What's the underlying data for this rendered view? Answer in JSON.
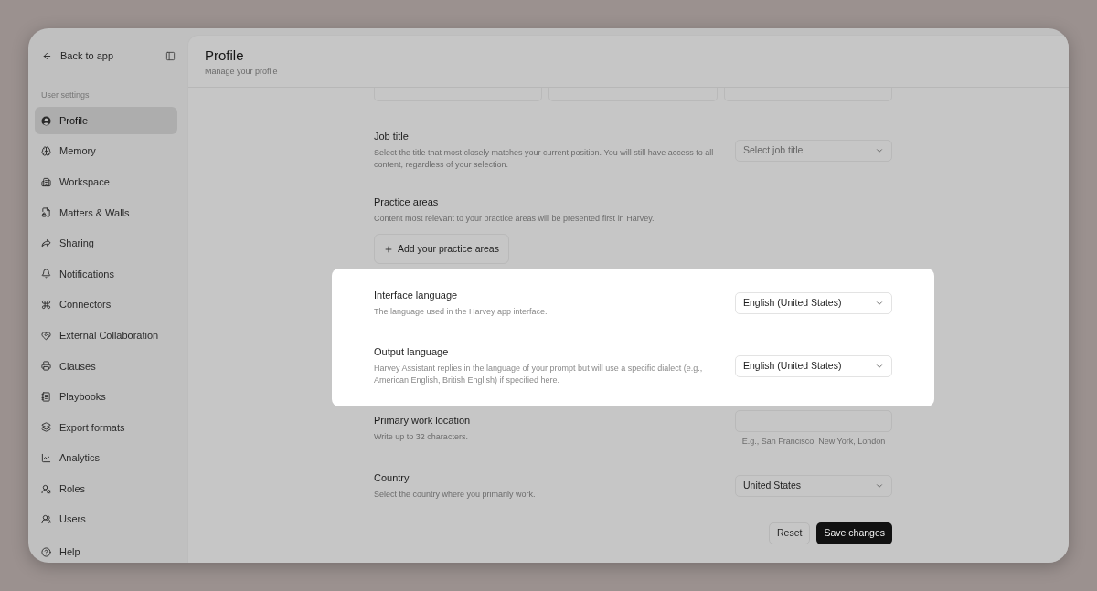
{
  "sidebar": {
    "back": "Back to app",
    "section": "User settings",
    "items": [
      {
        "label": "Profile",
        "selected": true
      },
      {
        "label": "Memory",
        "selected": false
      },
      {
        "label": "Workspace",
        "selected": false
      },
      {
        "label": "Matters & Walls",
        "selected": false
      },
      {
        "label": "Sharing",
        "selected": false
      },
      {
        "label": "Notifications",
        "selected": false
      },
      {
        "label": "Connectors",
        "selected": false
      },
      {
        "label": "External Collaboration",
        "selected": false
      },
      {
        "label": "Clauses",
        "selected": false
      },
      {
        "label": "Playbooks",
        "selected": false
      },
      {
        "label": "Export formats",
        "selected": false
      },
      {
        "label": "Analytics",
        "selected": false
      },
      {
        "label": "Roles",
        "selected": false
      },
      {
        "label": "Users",
        "selected": false
      }
    ],
    "footer": [
      {
        "label": "Help",
        "selected": false
      }
    ]
  },
  "header": {
    "title": "Profile",
    "subtitle": "Manage your profile"
  },
  "form": {
    "partial_inputs": [
      {
        "kind": "input"
      },
      {
        "kind": "input"
      },
      {
        "kind": "input"
      }
    ],
    "sections": [
      {
        "highlighted": false,
        "fields": [
          {
            "kind": "select",
            "label": "Job title",
            "description": "Select the title that most closely matches your current position. You will still have access to all content, regardless of your selection.",
            "placeholder": "Select job title"
          },
          {
            "kind": "button",
            "label": "Practice areas",
            "description": "Content most relevant to your practice areas will be presented first in Harvey.",
            "button": "Add your practice areas"
          }
        ]
      },
      {
        "highlighted": true,
        "fields": [
          {
            "kind": "select",
            "label": "Interface language",
            "description": "The language used in the Harvey app interface.",
            "value": "English (United States)"
          },
          {
            "kind": "select",
            "label": "Output language",
            "description": "Harvey Assistant replies in the language of your prompt but will use a specific dialect (e.g., American English, British English) if specified here.",
            "value": "English (United States)"
          }
        ]
      },
      {
        "highlighted": false,
        "fields": [
          {
            "kind": "text_input",
            "label": "Primary work location",
            "description": "Write up to 32 characters.",
            "helper": "E.g., San Francisco, New York, London"
          },
          {
            "kind": "select",
            "label": "Country",
            "description": "Select the country where you primarily work.",
            "value": "United States"
          }
        ]
      }
    ],
    "actions": [
      {
        "kind": "secondary",
        "label": "Reset"
      },
      {
        "kind": "primary",
        "label": "Save changes"
      }
    ]
  }
}
